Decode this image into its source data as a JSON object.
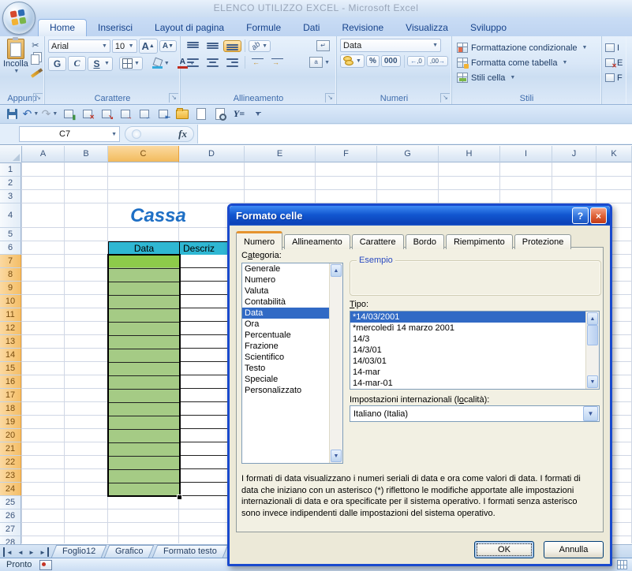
{
  "window": {
    "title": "ELENCO UTILIZZO EXCEL - Microsoft Excel"
  },
  "ribbon": {
    "tabs": [
      {
        "label": "Home",
        "active": true
      },
      {
        "label": "Inserisci"
      },
      {
        "label": "Layout di pagina"
      },
      {
        "label": "Formule"
      },
      {
        "label": "Dati"
      },
      {
        "label": "Revisione"
      },
      {
        "label": "Visualizza"
      },
      {
        "label": "Sviluppo"
      }
    ],
    "appunti": {
      "label": "Appunti",
      "paste": "Incolla"
    },
    "carattere": {
      "label": "Carattere",
      "font": "Arial",
      "size": "10",
      "bold": "G",
      "italic": "C",
      "underline": "S"
    },
    "allineamento": {
      "label": "Allineamento"
    },
    "numeri": {
      "label": "Numeri",
      "format": "Data",
      "percent": "%",
      "thousands": "000",
      "dec_more": ",0",
      "dec_less": ",00"
    },
    "stili": {
      "label": "Stili",
      "items": [
        "Formattazione condizionale",
        "Formatta come tabella",
        "Stili cella"
      ]
    },
    "celle": {
      "partial": [
        "I",
        "E",
        "F"
      ]
    }
  },
  "qat": {
    "filter_label": "Y="
  },
  "formula_bar": {
    "name_box": "C7",
    "fx": "fx"
  },
  "sheet": {
    "columns": [
      "A",
      "B",
      "C",
      "D",
      "E",
      "F",
      "G",
      "H",
      "I",
      "J",
      "K"
    ],
    "selected_column": "C",
    "row_count": 28,
    "selected_row_start": 7,
    "selected_row_end": 24,
    "title": "Cassa",
    "table": {
      "date_header": "Data",
      "desc_header": "Descriz"
    }
  },
  "sheet_tabs": [
    "Foglio12",
    "Grafico",
    "Formato testo"
  ],
  "status_bar": {
    "text": "Pronto"
  },
  "dialog": {
    "title": "Formato celle",
    "tabs": [
      "Numero",
      "Allineamento",
      "Carattere",
      "Bordo",
      "Riempimento",
      "Protezione"
    ],
    "active_tab": "Numero",
    "category_label": "Categoria:",
    "categories": [
      "Generale",
      "Numero",
      "Valuta",
      "Contabilità",
      "Data",
      "Ora",
      "Percentuale",
      "Frazione",
      "Scientifico",
      "Testo",
      "Speciale",
      "Personalizzato"
    ],
    "selected_category": "Data",
    "example_label": "Esempio",
    "type_label": "Tipo:",
    "types": [
      "*14/03/2001",
      "*mercoledì 14 marzo 2001",
      "14/3",
      "14/3/01",
      "14/03/01",
      "14-mar",
      "14-mar-01"
    ],
    "selected_type": "*14/03/2001",
    "locale_label": "Impostazioni internazionali (località):",
    "locale_value": "Italiano (Italia)",
    "description": "I formati di data visualizzano i numeri seriali di data e ora come valori di data. I formati di data che iniziano con un asterisco (*) riflettono le modifiche apportate alle impostazioni internazionali di data e ora specificate per il sistema operativo. I formati senza asterisco sono invece indipendenti dalle impostazioni del sistema operativo.",
    "ok": "OK",
    "cancel": "Annulla"
  },
  "colors": {
    "range_green": "#A5CB85",
    "active_cell_green": "#8DCB4A",
    "table_header_turquoise": "#2FB7D3",
    "cassa_blue": "#1E6FC5",
    "dialog_selection_blue": "#316AC5",
    "grid_line": "#D0D7E5",
    "ribbon_highlight_orange": "#FFD58D"
  }
}
